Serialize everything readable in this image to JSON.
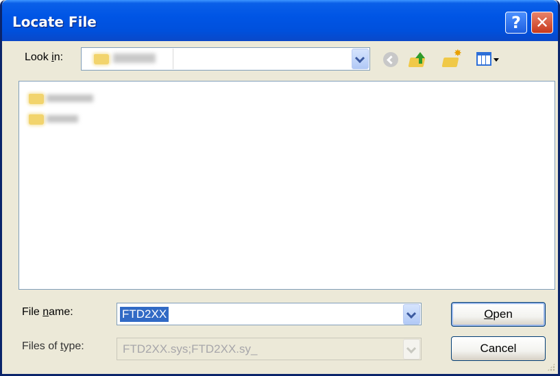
{
  "window": {
    "title": "Locate File",
    "help_label": "?",
    "close_label": "✕"
  },
  "look_in": {
    "label_pre": "Look ",
    "label_key": "i",
    "label_post": "n:"
  },
  "toolbar": {
    "icons": [
      "back-icon",
      "up-one-level-icon",
      "new-folder-icon",
      "views-menu-icon"
    ]
  },
  "file_name": {
    "label_pre": "File ",
    "label_key": "n",
    "label_post": "ame:",
    "value": "FTD2XX"
  },
  "files_of_type": {
    "label_pre": "Files of ",
    "label_key": "t",
    "label_post": "ype:",
    "value": "FTD2XX.sys;FTD2XX.sy_"
  },
  "buttons": {
    "open_key": "O",
    "open_rest": "pen",
    "cancel": "Cancel"
  },
  "colors": {
    "titlebar": "#0055E5",
    "window_bg": "#ECE9D8",
    "selection": "#316AC5"
  }
}
